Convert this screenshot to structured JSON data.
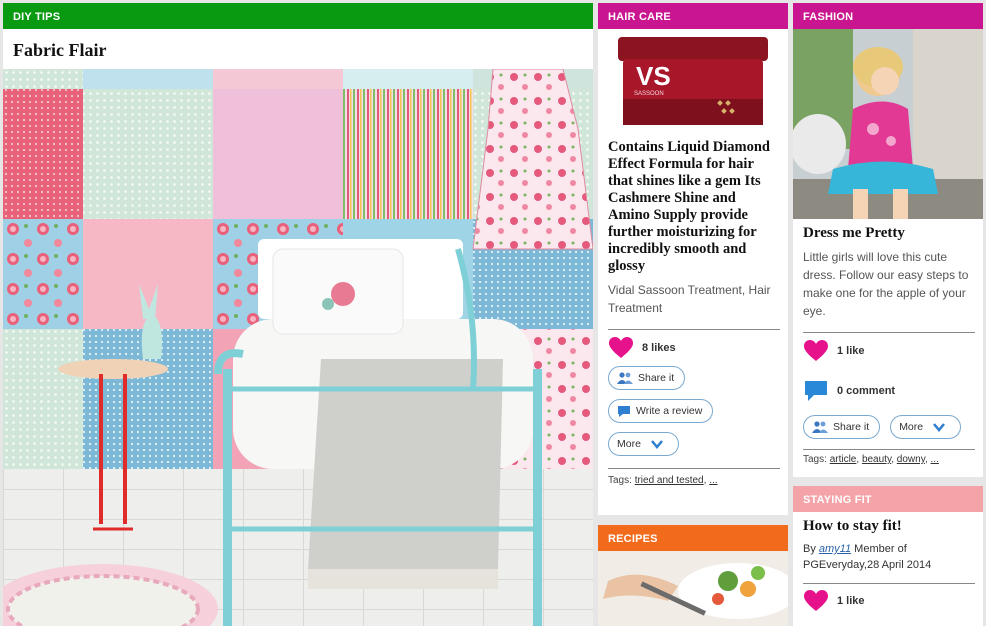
{
  "colors": {
    "diy": "#0a9a12",
    "hair": "#c9158f",
    "fashion": "#c9158f",
    "recipes": "#f26a1b",
    "fit": "#f4a3a8"
  },
  "diy": {
    "category": "DIY TIPS",
    "title": "Fabric Flair"
  },
  "hair": {
    "category": "HAIR CARE",
    "title": "Contains Liquid Diamond Effect Formula for hair that shines like a gem Its Cashmere Shine and Amino Supply provide further moisturizing for incredibly smooth and glossy",
    "subtitle": "Vidal Sassoon Treatment, Hair Treatment",
    "likes": "8 likes",
    "share": "Share it",
    "review": "Write a review",
    "more": "More",
    "tags_label": "Tags:",
    "tags": [
      "tried and tested",
      "..."
    ],
    "product_logo": "VS",
    "product_brand": "SASSOON"
  },
  "recipes": {
    "category": "RECIPES"
  },
  "fashion": {
    "category": "FASHION",
    "title": "Dress me Pretty",
    "description": "Little girls will love this cute dress. Follow our easy steps to make one for the apple of your eye.",
    "likes": "1 like",
    "comments": "0 comment",
    "share": "Share it",
    "more": "More",
    "tags_label": "Tags:",
    "tags": [
      "article",
      "beauty",
      "downy",
      "..."
    ]
  },
  "fit": {
    "category": "STAYING FIT",
    "title": "How to stay fit!",
    "by": "By",
    "author": "amy11",
    "member_text": "Member of PGEveryday,28 April 2014",
    "likes": "1 like"
  }
}
